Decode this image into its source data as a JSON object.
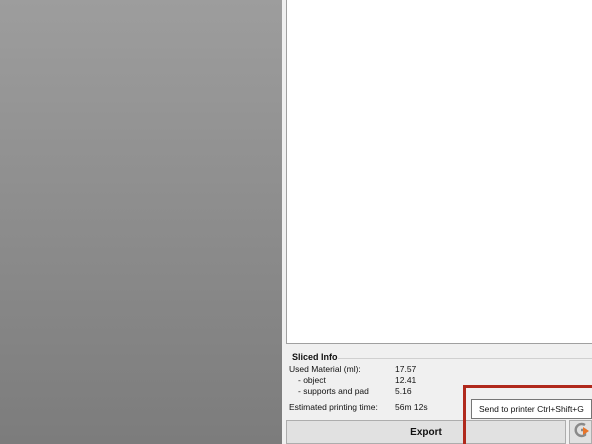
{
  "sliced_info": {
    "title": "Sliced Info",
    "rows": [
      {
        "label": "Used Material (ml):",
        "value": "17.57"
      },
      {
        "label": "- object",
        "value": "12.41"
      },
      {
        "label": "- supports and pad",
        "value": "5.16"
      },
      {
        "label": "Estimated printing time:",
        "value": "56m 12s"
      }
    ]
  },
  "actions": {
    "export_label": "Export",
    "send_icon": "send-to-printer-icon"
  },
  "tooltip": {
    "text": "Send to printer Ctrl+Shift+G"
  },
  "colors": {
    "highlight": "#b0291c",
    "send_icon_gray": "#8a8a8a",
    "send_icon_orange": "#e8742a"
  }
}
